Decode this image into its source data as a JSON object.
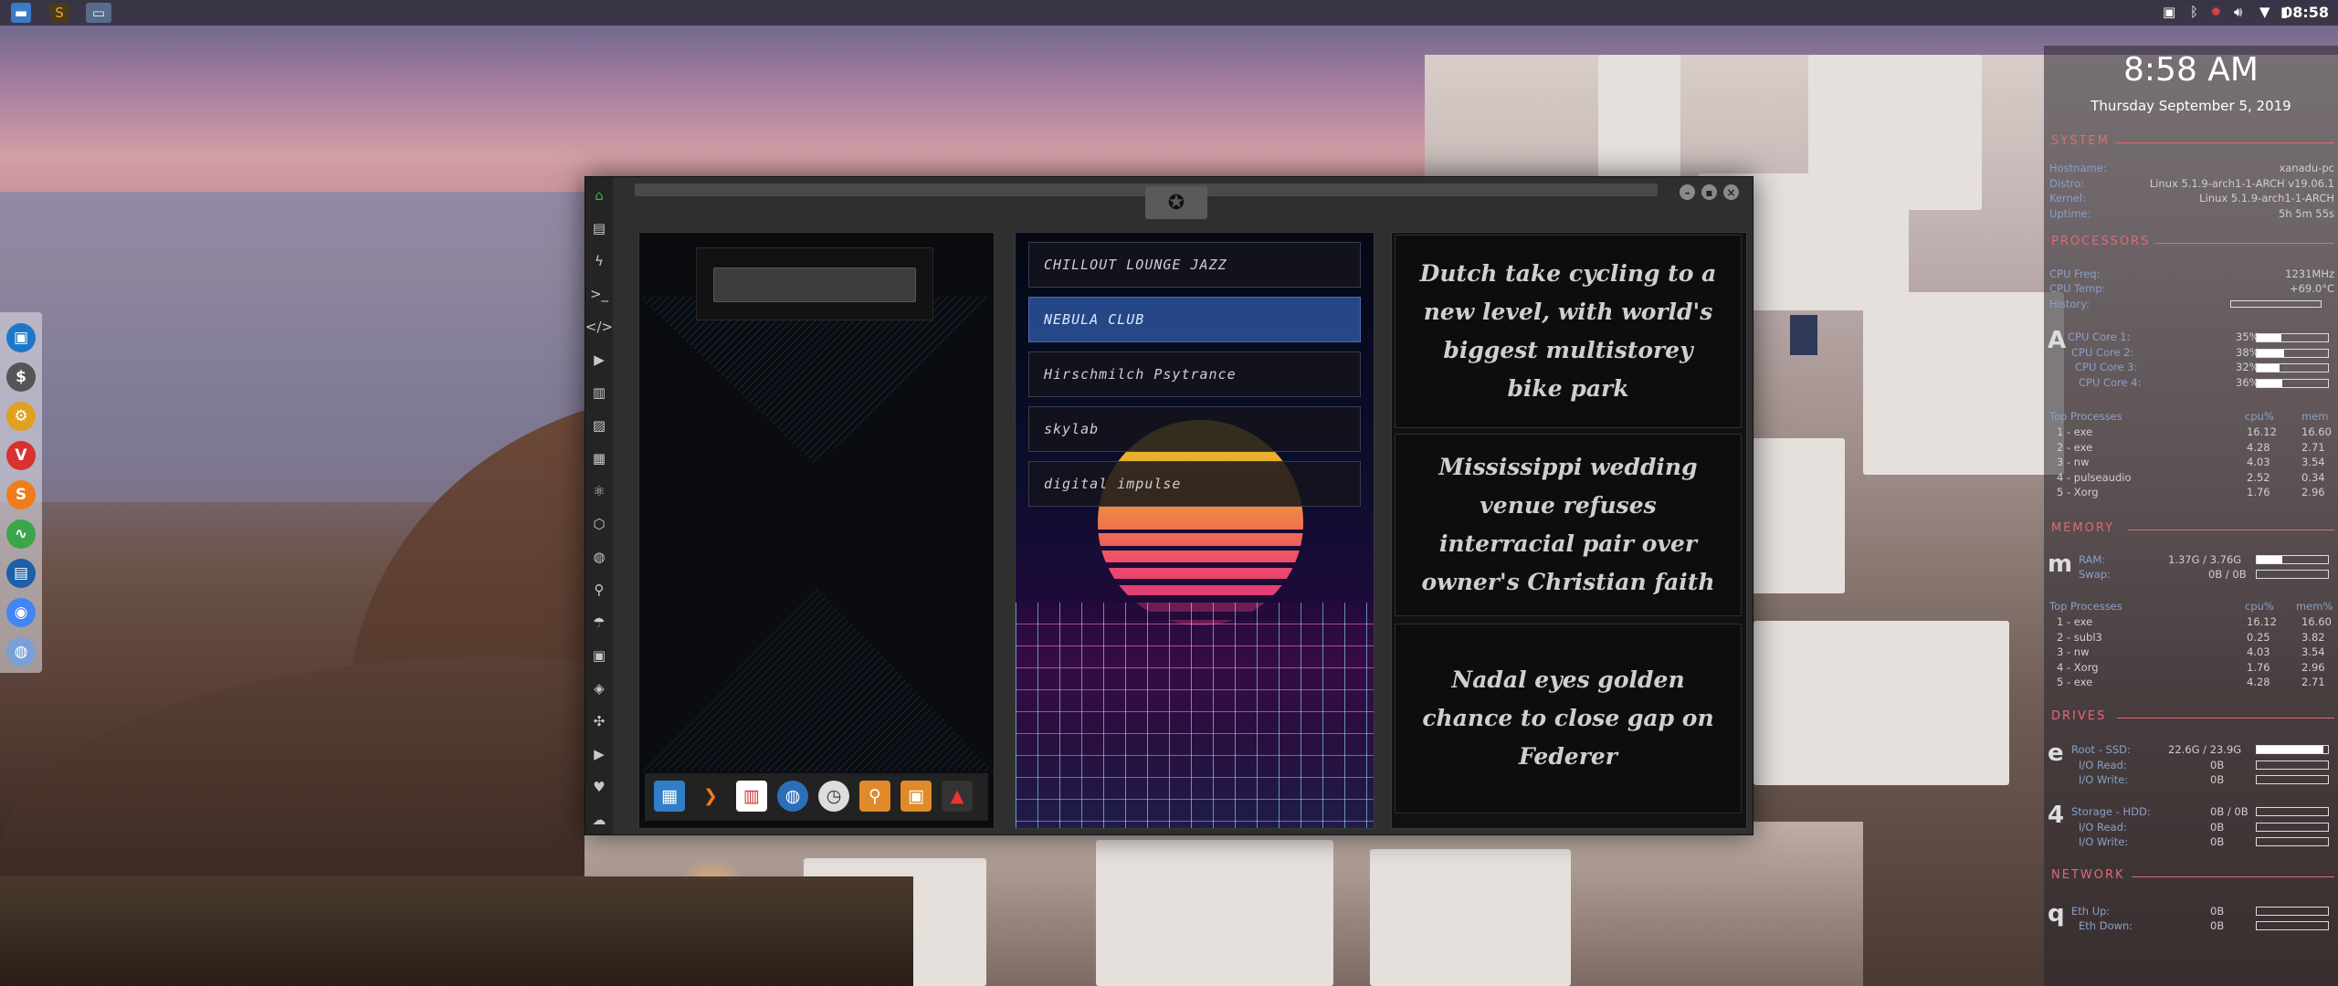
{
  "topbar": {
    "launchers": [
      "files-icon",
      "sublime-icon",
      "workspace-icon"
    ],
    "clock": "08:58"
  },
  "dock": {
    "items": [
      {
        "name": "files-app-icon",
        "glyph": "▣",
        "color": "#1b78c8"
      },
      {
        "name": "money-app-icon",
        "glyph": "$",
        "color": "#555555"
      },
      {
        "name": "settings-app-icon",
        "glyph": "⚙",
        "color": "#e0a020"
      },
      {
        "name": "vivaldi-icon",
        "glyph": "V",
        "color": "#d8312f"
      },
      {
        "name": "sublime-app-icon",
        "glyph": "S",
        "color": "#f07d1a"
      },
      {
        "name": "activity-icon",
        "glyph": "∿",
        "color": "#3aa64a"
      },
      {
        "name": "remote-desktop-icon",
        "glyph": "▤",
        "color": "#1d5fa8"
      },
      {
        "name": "chrome-icon",
        "glyph": "◉",
        "color": "#4285f4"
      },
      {
        "name": "network-grid-icon",
        "glyph": "◍",
        "color": "#7aa0d8"
      }
    ]
  },
  "app": {
    "playlist": [
      {
        "label": "CHILLOUT LOUNGE JAZZ",
        "active": false
      },
      {
        "label": "NEBULA CLUB",
        "active": true
      },
      {
        "label": "Hirschmilch Psytrance",
        "active": false
      },
      {
        "label": "skylab",
        "active": false
      },
      {
        "label": "digital impulse",
        "active": false
      }
    ],
    "news": [
      "Dutch take cycling to a new level, with world's biggest multistorey bike park",
      "Mississippi wedding venue refuses interracial pair over owner's Christian faith",
      "Nadal eyes golden chance to close gap on Federer"
    ]
  },
  "conky": {
    "time": "8:58 AM",
    "date": "Thursday September  5, 2019",
    "system": {
      "title": "SYSTEM",
      "rows": [
        {
          "label": "Hostname:",
          "value": "xanadu-pc"
        },
        {
          "label": "Distro:",
          "value": "Linux 5.1.9-arch1-1-ARCH v19.06.1"
        },
        {
          "label": "Kernel:",
          "value": "Linux 5.1.9-arch1-1-ARCH"
        },
        {
          "label": "Uptime:",
          "value": "5h 5m 55s"
        }
      ]
    },
    "processors": {
      "title": "PROCESSORS",
      "freq_label": "CPU Freq:",
      "freq": "1231MHz",
      "temp_label": "CPU Temp:",
      "temp": "+69.0°C",
      "history_label": "History:",
      "letter": "A",
      "cores": [
        {
          "label": "CPU Core 1:",
          "value": "35%",
          "pct": 35
        },
        {
          "label": "CPU Core 2:",
          "value": "38%",
          "pct": 38
        },
        {
          "label": "CPU Core 3:",
          "value": "32%",
          "pct": 32
        },
        {
          "label": "CPU Core 4:",
          "value": "36%",
          "pct": 36
        }
      ],
      "top_title": "Top Processes",
      "col1": "cpu%",
      "col2": "mem",
      "top": [
        {
          "name": "1 - exe",
          "a": "16.12",
          "b": "16.60"
        },
        {
          "name": "2 - exe",
          "a": "4.28",
          "b": "2.71"
        },
        {
          "name": "3 - nw",
          "a": "4.03",
          "b": "3.54"
        },
        {
          "name": "4 - pulseaudio",
          "a": "2.52",
          "b": "0.34"
        },
        {
          "name": "5 - Xorg",
          "a": "1.76",
          "b": "2.96"
        }
      ]
    },
    "memory": {
      "title": "MEMORY",
      "letter": "m",
      "ram_label": "RAM:",
      "ram": "1.37G / 3.76G",
      "ram_pct": 36,
      "swap_label": "Swap:",
      "swap": "0B / 0B",
      "swap_pct": 0,
      "top_title": "Top Processes",
      "col1": "cpu%",
      "col2": "mem%",
      "top": [
        {
          "name": "1 - exe",
          "a": "16.12",
          "b": "16.60"
        },
        {
          "name": "2 - subl3",
          "a": "0.25",
          "b": "3.82"
        },
        {
          "name": "3 - nw",
          "a": "4.03",
          "b": "3.54"
        },
        {
          "name": "4 - Xorg",
          "a": "1.76",
          "b": "2.96"
        },
        {
          "name": "5 - exe",
          "a": "4.28",
          "b": "2.71"
        }
      ]
    },
    "drives": {
      "title": "DRIVES",
      "root": {
        "letter": "e",
        "label": "Root - SSD:",
        "value": "22.6G / 23.9G",
        "pct": 94,
        "read_label": "I/O Read:",
        "read": "0B",
        "write_label": "I/O Write:",
        "write": "0B"
      },
      "storage": {
        "letter": "4",
        "label": "Storage - HDD:",
        "value": "0B / 0B",
        "pct": 0,
        "read_label": "I/O Read:",
        "read": "0B",
        "write_label": "I/O Write:",
        "write": "0B"
      }
    },
    "network": {
      "title": "NETWORK",
      "letter": "q",
      "up_label": "Eth Up:",
      "up": "0B",
      "down_label": "Eth Down:",
      "down": "0B"
    }
  }
}
